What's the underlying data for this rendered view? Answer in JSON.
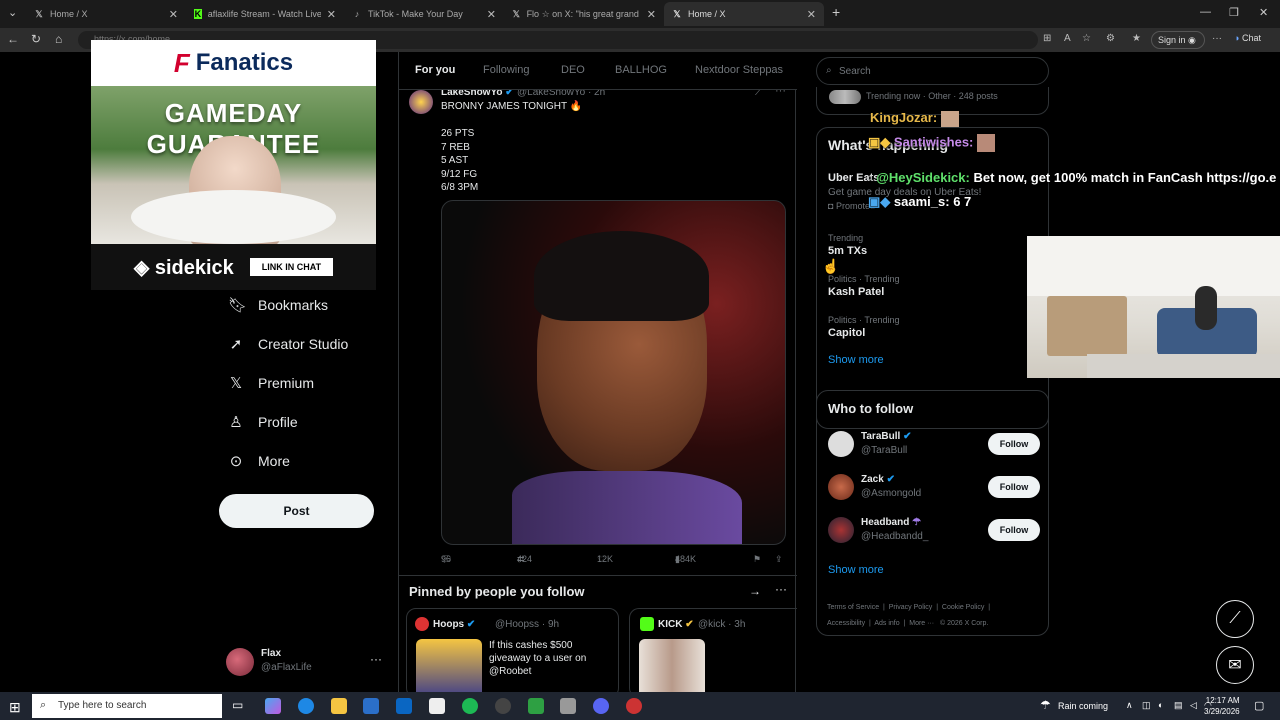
{
  "browser": {
    "tabs": [
      {
        "title": "Home / X",
        "icon": "x-icon"
      },
      {
        "title": "aflaxlife Stream - Watch Live on Kick",
        "icon": "kick-icon"
      },
      {
        "title": "TikTok - Make Your Day",
        "icon": "tiktok-icon"
      },
      {
        "title": "Flo ☆ on X: \"his great grand child",
        "icon": "x-icon"
      },
      {
        "title": "Home / X",
        "icon": "x-icon"
      }
    ],
    "url": "https://x.com/home",
    "signin_label": "Sign in",
    "chat_label": "Chat"
  },
  "ad": {
    "brand": "Fanatics",
    "headline": "GAMEDAY GUARANTEE",
    "sponsor": "sidekick",
    "cta": "LINK IN CHAT"
  },
  "nav": {
    "items": [
      {
        "label": "Bookmarks",
        "icon": "bookmark-icon"
      },
      {
        "label": "Creator Studio",
        "icon": "rocket-icon"
      },
      {
        "label": "Premium",
        "icon": "x-logo-icon"
      },
      {
        "label": "Profile",
        "icon": "person-icon"
      },
      {
        "label": "More",
        "icon": "more-circle-icon"
      }
    ],
    "post_label": "Post",
    "account": {
      "name": "Flax",
      "handle": "@aFlaxLife"
    }
  },
  "timeline": {
    "tabs": [
      "For you",
      "Following",
      "DEO",
      "BALLHOG",
      "Nextdoor Steppas"
    ],
    "tweet": {
      "name": "LakeShowYo",
      "handle": "@LakeShowYo · 2h",
      "text": "BRONNY JAMES TONIGHT 🔥\n\n26 PTS\n7 REB\n5 AST\n9/12 FG\n6/8 3PM",
      "replies": "96",
      "reposts": "424",
      "likes": "12K",
      "views": "484K"
    },
    "pinned": {
      "title": "Pinned by people you follow",
      "cards": [
        {
          "name": "Hoops",
          "handle": "@Hoopss · 9h",
          "text": "If this cashes $500 giveaway to a user on @Roobet"
        },
        {
          "name": "KICK",
          "handle": "@kick · 3h",
          "text": ""
        }
      ]
    }
  },
  "sidebar": {
    "search_placeholder": "Search",
    "trending_now": "Trending now · Other · 248 posts",
    "happening_title": "What's happening",
    "promo": {
      "name": "Uber Eats",
      "text": "Get game day deals on Uber Eats!",
      "label": "Promoted"
    },
    "trends": [
      {
        "context": "Trending",
        "name": "5m TXs"
      },
      {
        "context": "Politics · Trending",
        "name": "Kash Patel"
      },
      {
        "context": "Politics · Trending",
        "name": "Capitol"
      }
    ],
    "show_more": "Show more",
    "who_to_follow": "Who to follow",
    "follow_label": "Follow",
    "suggestions": [
      {
        "name": "TaraBull",
        "handle": "@TaraBull"
      },
      {
        "name": "Zack",
        "handle": "@Asmongold"
      },
      {
        "name": "Headband",
        "handle": "@Headbandd_"
      }
    ],
    "footer": [
      "Terms of Service",
      "Privacy Policy",
      "Cookie Policy",
      "Accessibility",
      "Ads info",
      "More ···",
      "© 2026 X Corp."
    ]
  },
  "stream_chat": [
    {
      "user": "KingJozar:",
      "color": "#e6b84a",
      "text": ""
    },
    {
      "user": "Santiwishes:",
      "color": "#c58ae8",
      "text": ""
    },
    {
      "user": "@HeySidekick:",
      "color": "#5fe06b",
      "text": "Bet now, get 100% match in FanCash https://go.e"
    },
    {
      "user": "saami_s:",
      "color": "#ffffff",
      "text": "6 7"
    }
  ],
  "taskbar": {
    "search_placeholder": "Type here to search",
    "weather": "Rain coming",
    "time": "12:17 AM",
    "date": "3/29/2026"
  }
}
